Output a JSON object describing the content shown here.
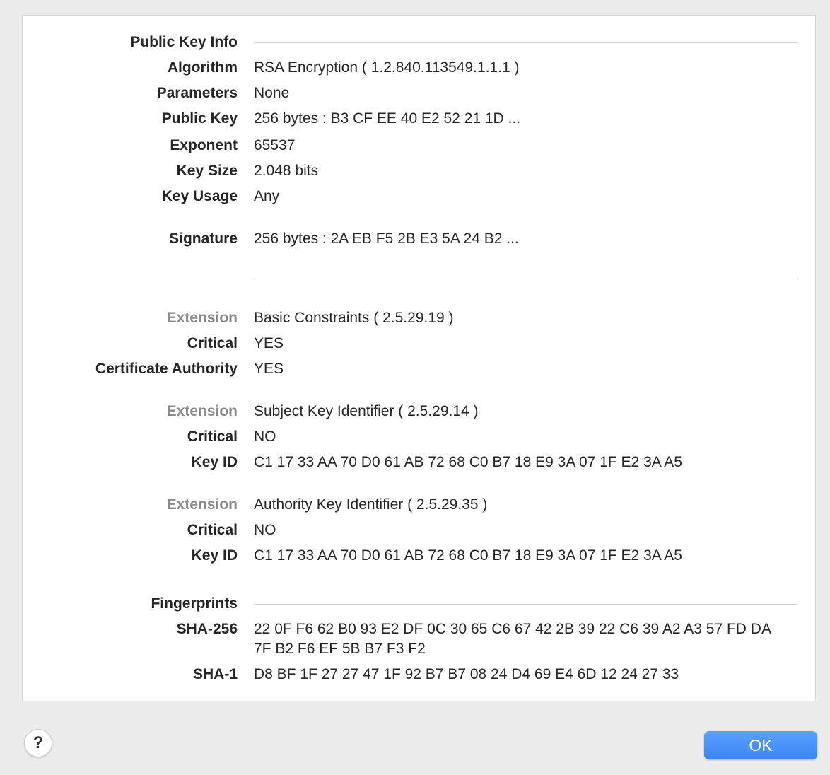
{
  "public_key_info": {
    "section_label": "Public Key Info",
    "algorithm_label": "Algorithm",
    "algorithm_value": "RSA Encryption ( 1.2.840.113549.1.1.1 )",
    "parameters_label": "Parameters",
    "parameters_value": "None",
    "public_key_label": "Public Key",
    "public_key_value": "256 bytes : B3 CF EE 40 E2 52 21 1D ...",
    "exponent_label": "Exponent",
    "exponent_value": "65537",
    "key_size_label": "Key Size",
    "key_size_value": "2.048 bits",
    "key_usage_label": "Key Usage",
    "key_usage_value": "Any",
    "signature_label": "Signature",
    "signature_value": "256 bytes : 2A EB F5 2B E3 5A 24 B2 ..."
  },
  "extensions": [
    {
      "extension_label": "Extension",
      "extension_value": "Basic Constraints ( 2.5.29.19 )",
      "critical_label": "Critical",
      "critical_value": "YES",
      "extra_label": "Certificate Authority",
      "extra_value": "YES"
    },
    {
      "extension_label": "Extension",
      "extension_value": "Subject Key Identifier ( 2.5.29.14 )",
      "critical_label": "Critical",
      "critical_value": "NO",
      "extra_label": "Key ID",
      "extra_value": "C1 17 33 AA 70 D0 61 AB 72 68 C0 B7 18 E9 3A 07 1F E2 3A A5"
    },
    {
      "extension_label": "Extension",
      "extension_value": "Authority Key Identifier ( 2.5.29.35 )",
      "critical_label": "Critical",
      "critical_value": "NO",
      "extra_label": "Key ID",
      "extra_value": "C1 17 33 AA 70 D0 61 AB 72 68 C0 B7 18 E9 3A 07 1F E2 3A A5"
    }
  ],
  "fingerprints": {
    "section_label": "Fingerprints",
    "sha256_label": "SHA-256",
    "sha256_value": "22 0F F6 62 B0 93 E2 DF 0C 30 65 C6 67 42 2B 39 22 C6 39 A2 A3 57 FD DA 7F B2 F6 EF 5B B7 F3 F2",
    "sha1_label": "SHA-1",
    "sha1_value": "D8 BF 1F 27 27 47 1F 92 B7 B7 08 24 D4 69 E4 6D 12 24 27 33"
  },
  "buttons": {
    "help_label": "?",
    "ok_label": "OK"
  },
  "colors": {
    "ok_button": "#3b84f4",
    "dim_label": "#8a8a8a"
  }
}
